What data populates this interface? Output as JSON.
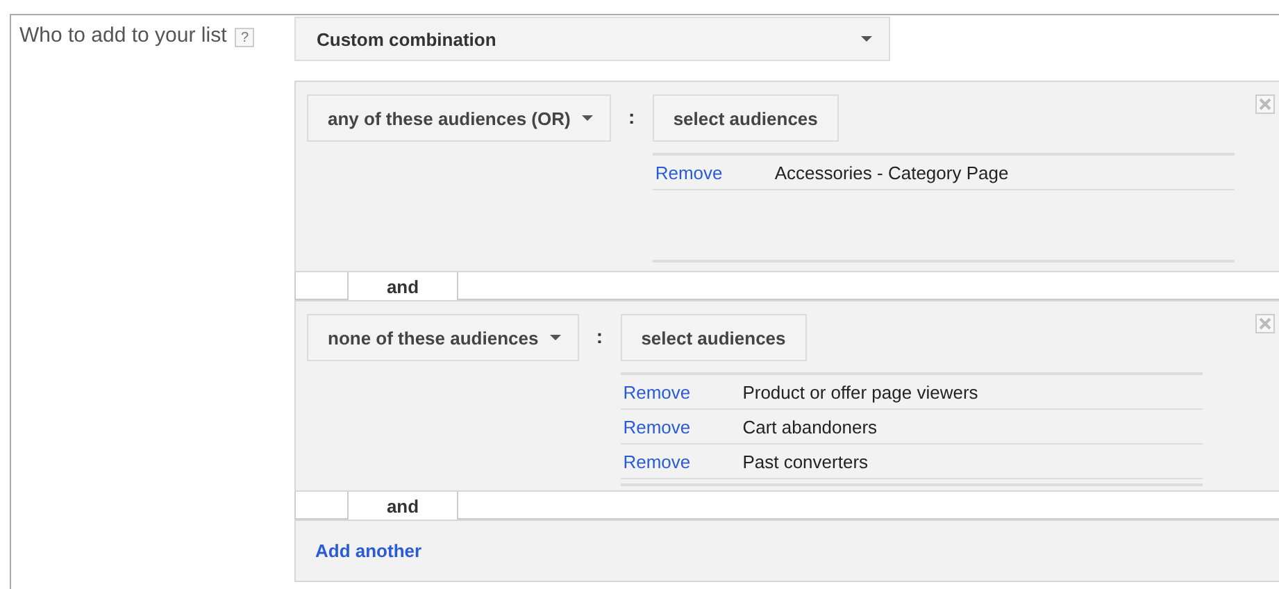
{
  "field": {
    "label": "Who to add to your list",
    "help": "?"
  },
  "combination": {
    "value": "Custom combination"
  },
  "groups": [
    {
      "operator": "any of these audiences (OR)",
      "separator": ":",
      "select_button": "select audiences",
      "audiences": [
        {
          "action": "Remove",
          "name": "Accessories - Category Page"
        }
      ],
      "connector": "and"
    },
    {
      "operator": "none of these audiences",
      "separator": ":",
      "select_button": "select audiences",
      "audiences": [
        {
          "action": "Remove",
          "name": "Product or offer page viewers"
        },
        {
          "action": "Remove",
          "name": "Cart abandoners"
        },
        {
          "action": "Remove",
          "name": "Past converters"
        }
      ],
      "connector": "and"
    }
  ],
  "add_another": "Add another"
}
